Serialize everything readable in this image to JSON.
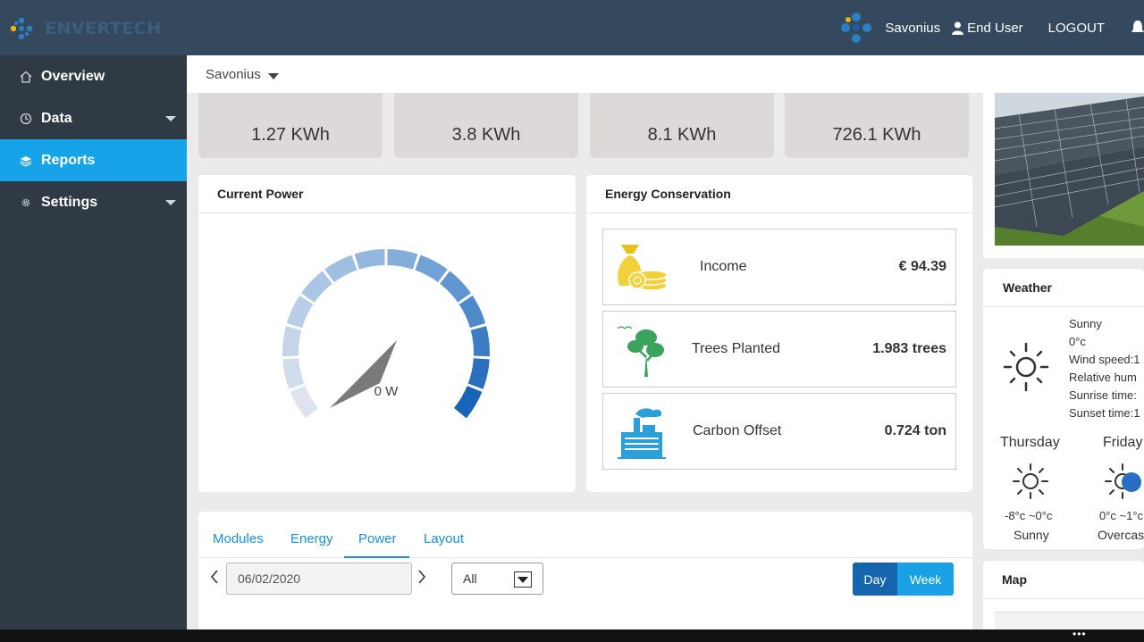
{
  "brand": {
    "name": "ENVERTECH"
  },
  "header": {
    "plant_name": "Savonius",
    "user_role": "End User",
    "logout_label": "LOGOUT"
  },
  "sidebar": {
    "items": [
      {
        "label": "Overview",
        "icon": "home-icon",
        "active": false,
        "has_submenu": false
      },
      {
        "label": "Data",
        "icon": "clock-icon",
        "active": false,
        "has_submenu": true
      },
      {
        "label": "Reports",
        "icon": "layers-icon",
        "active": true,
        "has_submenu": false
      },
      {
        "label": "Settings",
        "icon": "gear-icon",
        "active": false,
        "has_submenu": true
      }
    ]
  },
  "plant_selector": {
    "value": "Savonius"
  },
  "kpis": [
    {
      "value": "1.27 KWh"
    },
    {
      "value": "3.8 KWh"
    },
    {
      "value": "8.1 KWh"
    },
    {
      "value": "726.1 KWh"
    }
  ],
  "current_power": {
    "title": "Current Power",
    "value_label": "0 W",
    "needle_value": 0
  },
  "energy_conservation": {
    "title": "Energy Conservation",
    "rows": [
      {
        "label": "Income",
        "value": "€ 94.39",
        "icon": "money-bag-icon"
      },
      {
        "label": "Trees Planted",
        "value": "1.983 trees",
        "icon": "tree-icon"
      },
      {
        "label": "Carbon Offset",
        "value": "0.724 ton",
        "icon": "factory-icon"
      }
    ]
  },
  "report_tabs": {
    "tabs": [
      "Modules",
      "Energy",
      "Power",
      "Layout"
    ],
    "active": "Power"
  },
  "date_picker": {
    "value": "06/02/2020"
  },
  "filter_select": {
    "value": "All"
  },
  "period_buttons": {
    "day": "Day",
    "week": "Week"
  },
  "weather": {
    "title": "Weather",
    "details": [
      "Sunny",
      "0°c",
      "Wind speed:1",
      "Relative hum",
      "Sunrise time:",
      "Sunset time:1"
    ],
    "forecast": [
      {
        "day": "Thursday",
        "temp": "-8°c ~0°c",
        "condition": "Sunny",
        "icon": "sun-icon"
      },
      {
        "day": "Friday",
        "temp": "0°c ~1°c",
        "condition": "Overcas",
        "icon": "cloudy-icon"
      }
    ]
  },
  "map": {
    "title": "Map"
  },
  "colors": {
    "header_bg": "#34495e",
    "sidebar_bg": "#2f3a45",
    "active_nav": "#17a3e8",
    "gauge_dark": "#1e6fbf",
    "gauge_light": "#dde3ef"
  }
}
